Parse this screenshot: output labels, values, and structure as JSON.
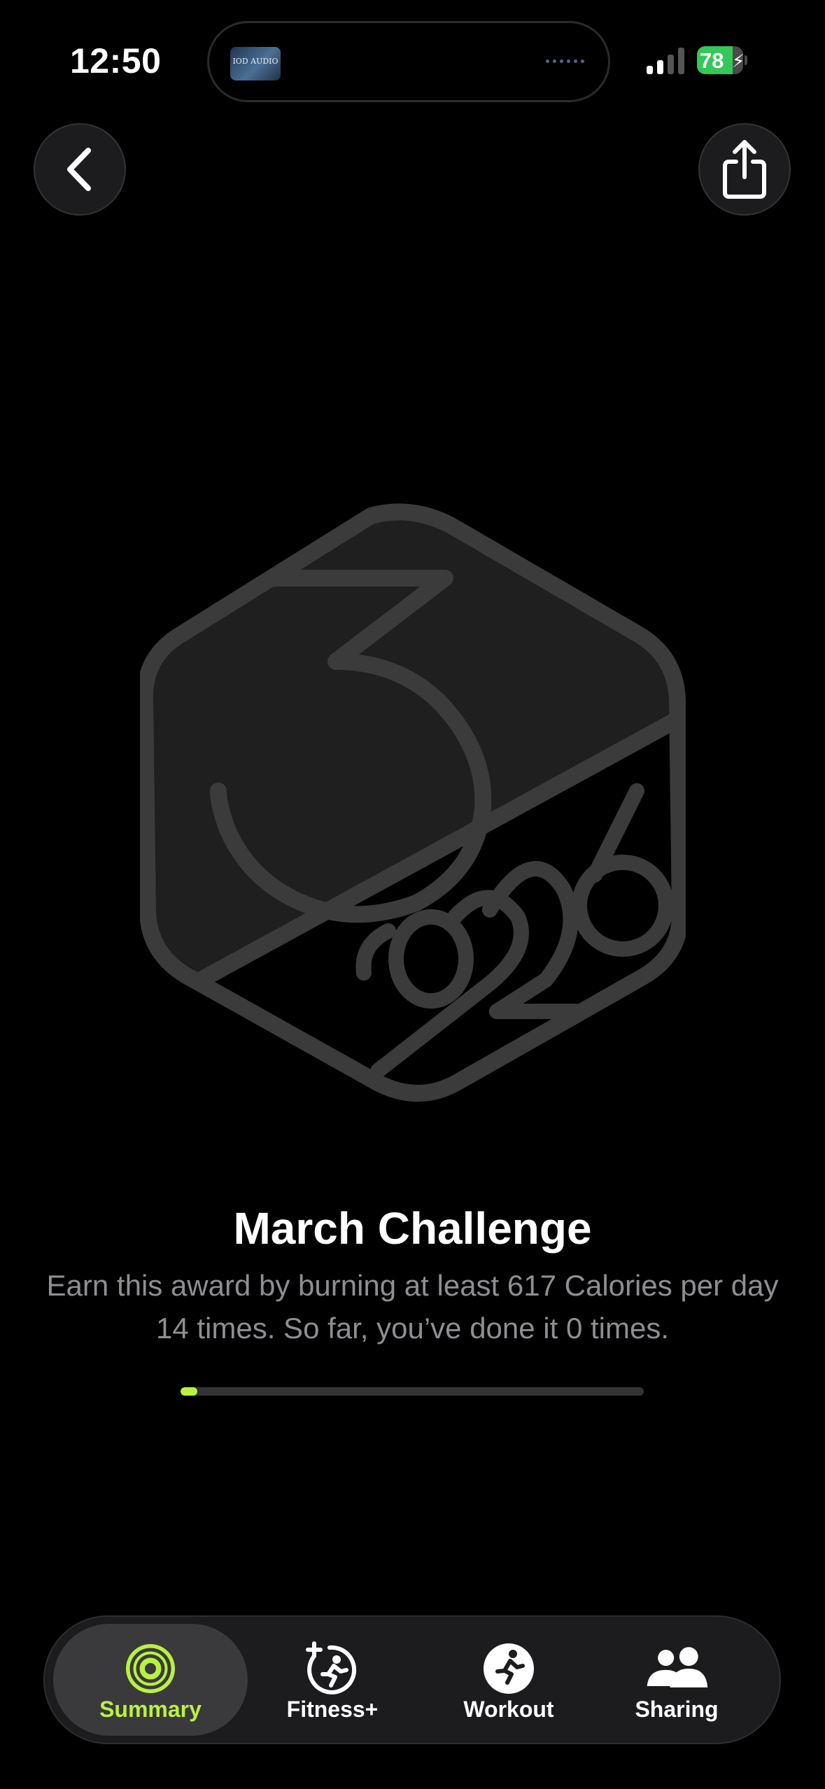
{
  "status_bar": {
    "time": "12:50",
    "now_playing_art_text": "IOD AUDIO",
    "battery_level": 78,
    "battery_text": "78",
    "battery_charging": true,
    "signal_bars_active": 2,
    "signal_bars_total": 4
  },
  "nav": {
    "back_icon": "chevron-left-icon",
    "share_icon": "share-icon"
  },
  "badge": {
    "icon": "march-2026-challenge-badge",
    "state": "locked"
  },
  "award": {
    "title": "March Challenge",
    "description": "Earn this award by burning at least 617 Calories per day 14 times. So far, you’ve done it 0 times.",
    "progress_done": 0,
    "progress_goal": 14
  },
  "tab_bar": {
    "active_tab": "summary",
    "tabs": [
      {
        "id": "summary",
        "label": "Summary",
        "icon": "activity-rings-icon"
      },
      {
        "id": "fitness",
        "label": "Fitness+",
        "icon": "fitness-plus-icon"
      },
      {
        "id": "workout",
        "label": "Workout",
        "icon": "running-figure-icon"
      },
      {
        "id": "sharing",
        "label": "Sharing",
        "icon": "people-icon"
      }
    ]
  },
  "colors": {
    "background": "#000000",
    "accent": "#b9f23f",
    "secondary_text": "#8e8e93",
    "badge_fill": "#1f1f1f",
    "badge_stroke": "#3b3b3c",
    "battery_green": "#34c759"
  }
}
